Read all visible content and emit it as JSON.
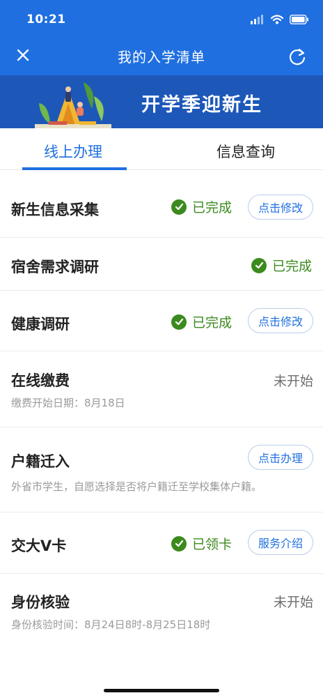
{
  "status_bar": {
    "time": "10:21"
  },
  "nav": {
    "title": "我的入学清单"
  },
  "banner": {
    "title": "开学季迎新生"
  },
  "tabs": [
    {
      "label": "线上办理",
      "active": true
    },
    {
      "label": "信息查询",
      "active": false
    }
  ],
  "items": [
    {
      "title": "新生信息采集",
      "status": "已完成",
      "action": "点击修改"
    },
    {
      "title": "宿舍需求调研",
      "status": "已完成"
    },
    {
      "title": "健康调研",
      "status": "已完成",
      "action": "点击修改"
    },
    {
      "title": "在线缴费",
      "status": "未开始",
      "subtitle": "缴费开始日期：8月18日"
    },
    {
      "title": "户籍迁入",
      "action": "点击办理",
      "subtitle": "外省市学生，自愿选择是否将户籍迁至学校集体户籍。"
    },
    {
      "title": "交大V卡",
      "status": "已领卡",
      "action": "服务介绍"
    },
    {
      "title": "身份核验",
      "status": "未开始",
      "subtitle": "身份核验时间：8月24日8时-8月25日18时"
    }
  ],
  "colors": {
    "primary": "#1f6fe0",
    "banner": "#1d58b9",
    "success": "#3b8a1e",
    "muted": "#9a9a9a"
  }
}
